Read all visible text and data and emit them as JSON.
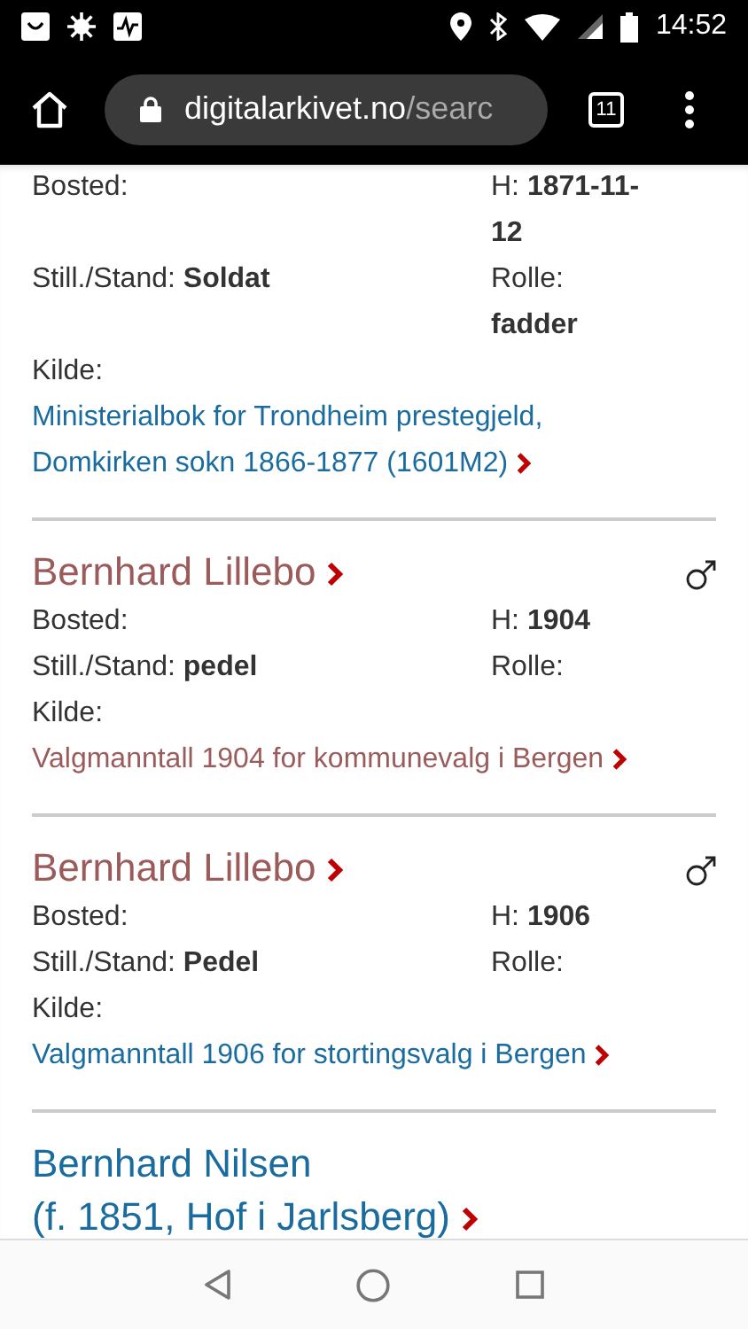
{
  "status_bar": {
    "time": "14:52"
  },
  "browser": {
    "url_host": "digitalarkivet.no",
    "url_path": "/searc",
    "tab_count": "11"
  },
  "entries": [
    {
      "fields_left": [
        {
          "label": "Bosted:"
        },
        {
          "label": "Still./Stand:",
          "value": "Soldat"
        }
      ],
      "fields_right": [
        {
          "label": "H:",
          "value": "1871-11-12"
        },
        {
          "label": "Rolle:",
          "value": "fadder"
        }
      ],
      "source_label": "Kilde:",
      "source": "Ministerialbok for Trondheim prestegjeld, Domkirken sokn 1866-1877 (1601M2)",
      "source_visited": false
    },
    {
      "name": "Bernhard Lillebo",
      "name_visited": true,
      "male": true,
      "fields_left": [
        {
          "label": "Bosted:"
        },
        {
          "label": "Still./Stand:",
          "value": "pedel"
        }
      ],
      "fields_right": [
        {
          "label": "H:",
          "value": "1904"
        },
        {
          "label": "Rolle:"
        }
      ],
      "source_label": "Kilde:",
      "source": "Valgmanntall 1904 for kommunevalg i Bergen",
      "source_visited": true
    },
    {
      "name": "Bernhard Lillebo",
      "name_visited": true,
      "male": true,
      "fields_left": [
        {
          "label": "Bosted:"
        },
        {
          "label": "Still./Stand:",
          "value": "Pedel"
        }
      ],
      "fields_right": [
        {
          "label": "H:",
          "value": "1906"
        },
        {
          "label": "Rolle:"
        }
      ],
      "source_label": "Kilde:",
      "source": "Valgmanntall 1906 for stortingsvalg i Bergen",
      "source_visited": false
    },
    {
      "name": "Bernhard Nilsen",
      "name_visited": false,
      "name_detail": "(f. 1851, Hof i Jarlsberg)"
    }
  ]
}
